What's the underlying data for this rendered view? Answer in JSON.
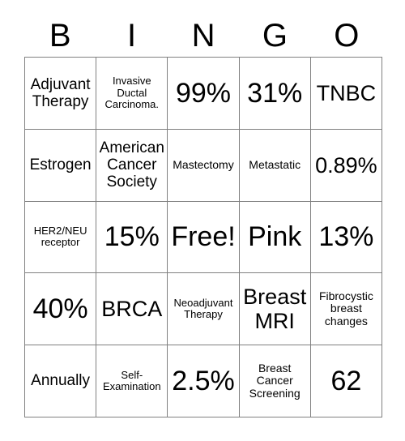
{
  "card": {
    "headers": [
      "B",
      "I",
      "N",
      "G",
      "O"
    ],
    "rows": [
      [
        {
          "text": "Adjuvant Therapy",
          "size": "md"
        },
        {
          "text": "Invasive Ductal Carcinoma.",
          "size": "xs"
        },
        {
          "text": "99%",
          "size": "xl"
        },
        {
          "text": "31%",
          "size": "xl"
        },
        {
          "text": "TNBC",
          "size": "lg"
        }
      ],
      [
        {
          "text": "Estrogen",
          "size": "md"
        },
        {
          "text": "American Cancer Society",
          "size": "md"
        },
        {
          "text": "Mastectomy",
          "size": "sm"
        },
        {
          "text": "Metastatic",
          "size": "sm"
        },
        {
          "text": "0.89%",
          "size": "lg"
        }
      ],
      [
        {
          "text": "HER2/NEU receptor",
          "size": "xs"
        },
        {
          "text": "15%",
          "size": "xl"
        },
        {
          "text": "Free!",
          "size": "xl"
        },
        {
          "text": "Pink",
          "size": "xl"
        },
        {
          "text": "13%",
          "size": "xl"
        }
      ],
      [
        {
          "text": "40%",
          "size": "xl"
        },
        {
          "text": "BRCA",
          "size": "lg"
        },
        {
          "text": "Neoadjuvant Therapy",
          "size": "xs"
        },
        {
          "text": "Breast MRI",
          "size": "lg"
        },
        {
          "text": "Fibrocystic breast changes",
          "size": "sm"
        }
      ],
      [
        {
          "text": "Annually",
          "size": "md"
        },
        {
          "text": "Self-Examination",
          "size": "xs"
        },
        {
          "text": "2.5%",
          "size": "xl"
        },
        {
          "text": "Breast Cancer Screening",
          "size": "sm"
        },
        {
          "text": "62",
          "size": "xl"
        }
      ]
    ]
  },
  "colors": {
    "grid_line": "#808080",
    "text": "#000000",
    "background": "#ffffff"
  }
}
